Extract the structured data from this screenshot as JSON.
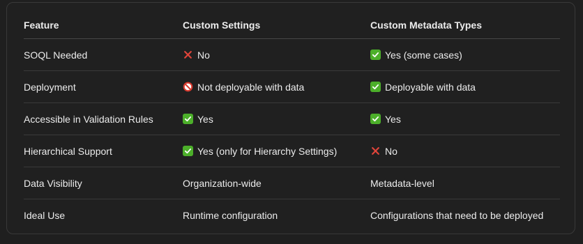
{
  "table": {
    "headers": [
      "Feature",
      "Custom Settings",
      "Custom Metadata Types"
    ],
    "rows": [
      {
        "feature": "SOQL Needed",
        "custom_settings": {
          "icon": "cross-icon",
          "text": "No"
        },
        "custom_metadata": {
          "icon": "check-icon",
          "text": "Yes (some cases)"
        }
      },
      {
        "feature": "Deployment",
        "custom_settings": {
          "icon": "prohibited-icon",
          "text": "Not deployable with data"
        },
        "custom_metadata": {
          "icon": "check-icon",
          "text": "Deployable with data"
        }
      },
      {
        "feature": "Accessible in Validation Rules",
        "custom_settings": {
          "icon": "check-icon",
          "text": "Yes"
        },
        "custom_metadata": {
          "icon": "check-icon",
          "text": "Yes"
        }
      },
      {
        "feature": "Hierarchical Support",
        "custom_settings": {
          "icon": "check-icon",
          "text": "Yes (only for Hierarchy Settings)"
        },
        "custom_metadata": {
          "icon": "cross-icon",
          "text": "No"
        }
      },
      {
        "feature": "Data Visibility",
        "custom_settings": {
          "icon": "",
          "text": "Organization-wide"
        },
        "custom_metadata": {
          "icon": "",
          "text": "Metadata-level"
        }
      },
      {
        "feature": "Ideal Use",
        "custom_settings": {
          "icon": "",
          "text": "Runtime configuration"
        },
        "custom_metadata": {
          "icon": "",
          "text": "Configurations that need to be deployed"
        }
      }
    ]
  },
  "colors": {
    "check": "#4caf2a",
    "cross": "#e0443a",
    "prohibited": "#d83a2e"
  }
}
